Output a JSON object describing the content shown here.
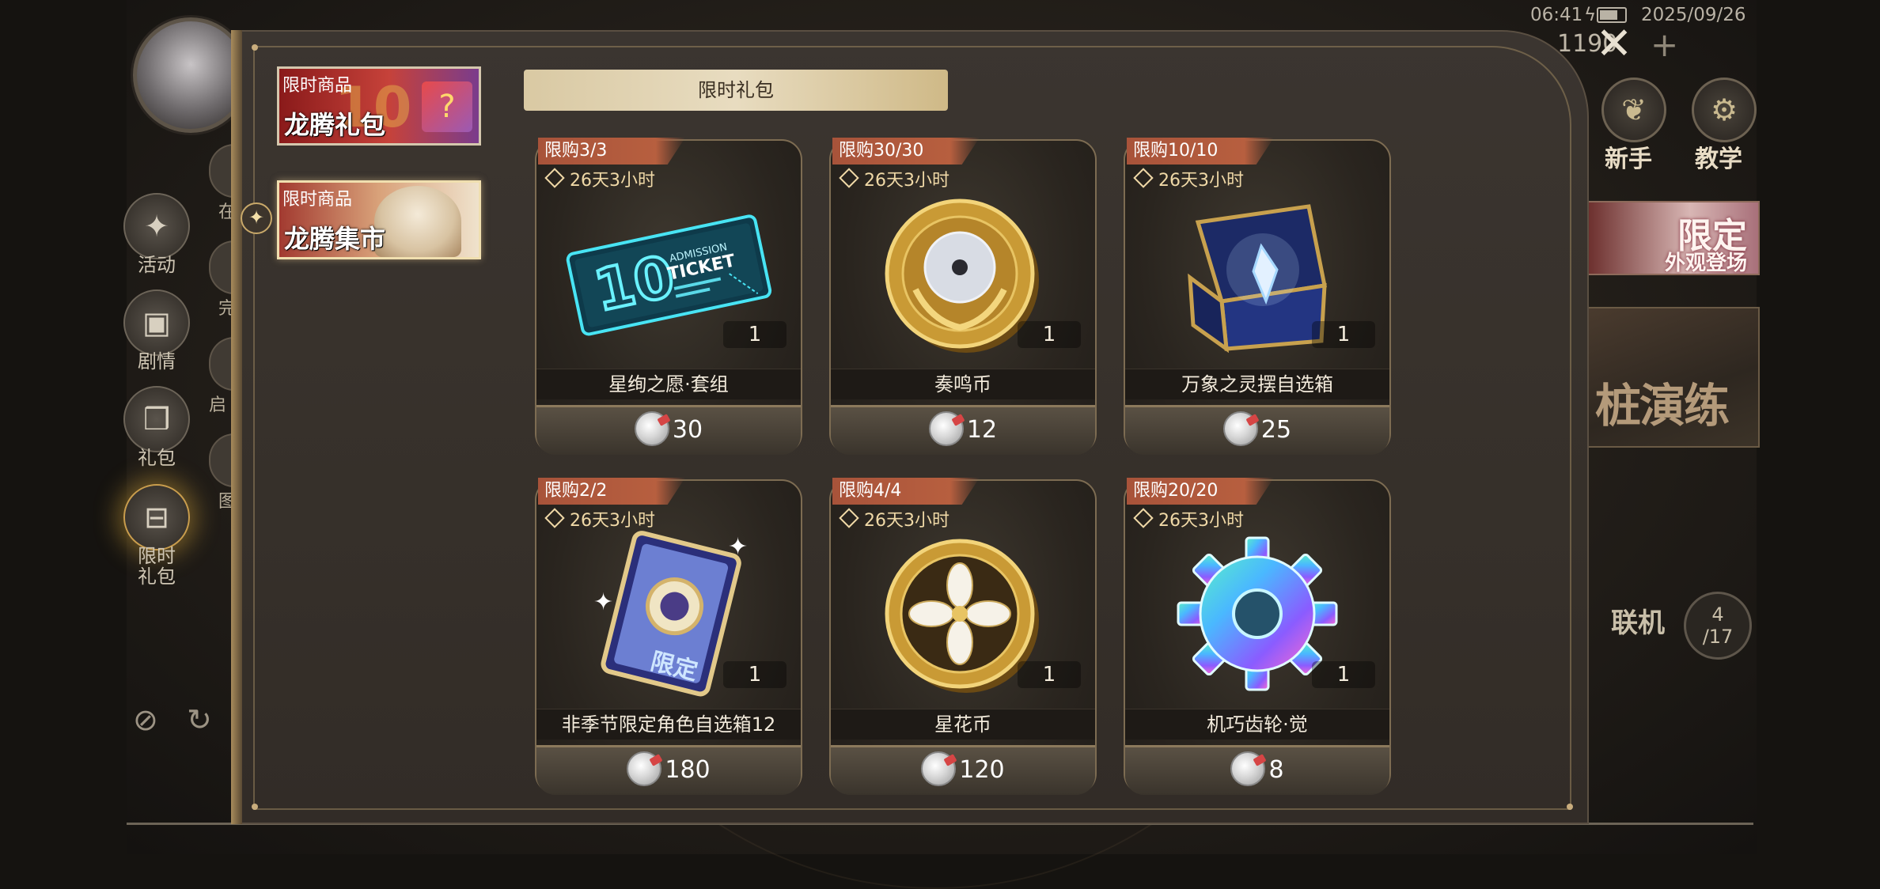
{
  "status_bar": {
    "time": "06:41",
    "date": "2025/09/26"
  },
  "top_right": {
    "currency_value": "1190"
  },
  "game_sidebar": {
    "buttons": [
      {
        "label": "活动",
        "icon": "confetti-icon"
      },
      {
        "label": "剧情",
        "icon": "clapperboard-icon"
      },
      {
        "label": "礼包",
        "icon": "gift-box-icon"
      },
      {
        "label": "限时\n礼包",
        "icon": "limited-gift-icon"
      }
    ],
    "peek_labels": [
      "在",
      "完",
      "启",
      "图"
    ]
  },
  "game_right": {
    "buttons": [
      {
        "label": "新手",
        "icon": "sprout-icon"
      },
      {
        "label": "教学",
        "icon": "gear-badge-icon"
      }
    ],
    "banner_limited": {
      "line1": "限定",
      "line2": "外观登场"
    },
    "banner_training": "桩演练",
    "coop_label": "联机",
    "coop_count": "4",
    "coop_total": "/17"
  },
  "shop": {
    "categories": [
      {
        "tag": "限时商品",
        "name": "龙腾礼包",
        "active": false
      },
      {
        "tag": "限时商品",
        "name": "龙腾集市",
        "active": true
      }
    ],
    "section_title": "限时礼包",
    "products": [
      {
        "limit": "限购3/3",
        "timer": "26天3小时",
        "quantity": "1",
        "name": "星绚之愿·套组",
        "price": "30",
        "art": "admission-ticket-icon"
      },
      {
        "limit": "限购30/30",
        "timer": "26天3小时",
        "quantity": "1",
        "name": "奏鸣币",
        "price": "12",
        "art": "sonata-coin-icon"
      },
      {
        "limit": "限购10/10",
        "timer": "26天3小时",
        "quantity": "1",
        "name": "万象之灵摆自选箱",
        "price": "25",
        "art": "pendulum-chest-icon"
      },
      {
        "limit": "限购2/2",
        "timer": "26天3小时",
        "quantity": "1",
        "name": "非季节限定角色自选箱12",
        "price": "180",
        "art": "character-book-icon"
      },
      {
        "limit": "限购4/4",
        "timer": "26天3小时",
        "quantity": "1",
        "name": "星花币",
        "price": "120",
        "art": "star-flower-coin-icon"
      },
      {
        "limit": "限购20/20",
        "timer": "26天3小时",
        "quantity": "1",
        "name": "机巧齿轮·觉",
        "price": "8",
        "art": "rainbow-gear-icon"
      }
    ],
    "ticket_art_text": {
      "top": "ADMISSION",
      "main": "TICKET",
      "number": "10"
    },
    "book_art_text": "限定"
  },
  "colors": {
    "accent_gold": "#d9c9a3",
    "limit_tag": "#b75f3f",
    "timer_text": "#f0d9a7"
  }
}
